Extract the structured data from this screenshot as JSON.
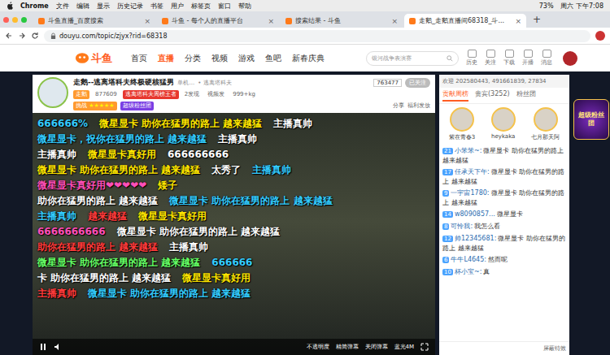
{
  "menubar": {
    "app": "Chrome",
    "items": [
      "文件",
      "编辑",
      "显示",
      "历史记录",
      "书签",
      "用户",
      "标签页",
      "窗口",
      "帮助"
    ],
    "battery": "73%",
    "clock": "周六 下午7:08"
  },
  "tabs": [
    {
      "label": "斗鱼直播_百度搜索",
      "selected": false
    },
    {
      "label": "斗鱼 - 每个人的直播平台",
      "selected": false
    },
    {
      "label": "搜索结果 - 斗鱼",
      "selected": false
    },
    {
      "label": "走鹅_走鹅直播间68318_斗...",
      "selected": true
    }
  ],
  "tab_close": "×",
  "new_tab": "+",
  "address": "douyu.com/topic/zjyx?rid=68318",
  "site_nav": {
    "logo": "斗鱼",
    "links": [
      {
        "label": "首页",
        "selected": false
      },
      {
        "label": "直播",
        "selected": true
      },
      {
        "label": "分类",
        "selected": false
      },
      {
        "label": "视频",
        "selected": false
      },
      {
        "label": "游戏",
        "selected": false
      },
      {
        "label": "鱼吧",
        "selected": false
      },
      {
        "label": "新春庆典",
        "selected": false
      }
    ],
    "search_placeholder": "银河战争表演赛",
    "actions": [
      "历史",
      "关注",
      "下载",
      "开播",
      "消息"
    ]
  },
  "room": {
    "title": "走鹅--逃离塔科夫终极硬核猛男",
    "category": "单机...",
    "game": "• 逃离塔科夫",
    "room_id": "763477",
    "follow": "已关注",
    "anchor": "走鹅",
    "hot": "877609",
    "rank_badge": "逃离塔科夫周榜王者",
    "stats": [
      "2发现",
      "视频发",
      "999+kg"
    ],
    "level_label": "挑战",
    "star_glyph": "★",
    "stars": 5,
    "fan_club": "超级粉丝团",
    "share": "分享",
    "welfare": "福利发放"
  },
  "danmaku_rows": [
    [
      {
        "text": "666666%",
        "color": "#33ccff"
      },
      {
        "text": "微星显卡 助你在猛男的路上 越来越猛",
        "color": "#ffe600"
      },
      {
        "text": "主播真帅",
        "color": "#ffffff"
      }
    ],
    [
      {
        "text": "微星显卡，祝你在猛男的路上 越来越猛",
        "color": "#33ccff"
      },
      {
        "text": "主播真帅",
        "color": "#ffffff"
      }
    ],
    [
      {
        "text": "主播真帅",
        "color": "#ffffff"
      },
      {
        "text": "微星显卡真好用",
        "color": "#ffe600"
      },
      {
        "text": "666666666",
        "color": "#ffffff"
      }
    ],
    [
      {
        "text": "微星显卡 助你在猛男的路上 越来越猛",
        "color": "#ffe600"
      },
      {
        "text": "太秀了",
        "color": "#ffffff"
      },
      {
        "text": "主播真帅",
        "color": "#33ccff"
      }
    ],
    [
      {
        "text": "微星显卡真好用❤❤❤❤❤",
        "color": "#ff4fb8"
      },
      {
        "text": "矮子",
        "color": "#ffe600"
      }
    ],
    [
      {
        "text": "助你在猛男的路上 越来越猛",
        "color": "#ffffff"
      },
      {
        "text": "微星显卡 助你在猛男的路上 越来越猛",
        "color": "#33ccff"
      }
    ],
    [
      {
        "text": "主播真帅",
        "color": "#33ccff"
      },
      {
        "text": "越来越猛",
        "color": "#ff3b3b"
      },
      {
        "text": "微星显卡真好用",
        "color": "#ffe600"
      }
    ],
    [
      {
        "text": "6666666666",
        "color": "#ff4fb8"
      },
      {
        "text": "微星显卡 助你在猛男的路上 越来越猛",
        "color": "#ffffff"
      }
    ],
    [
      {
        "text": "助你在猛男的路上 越来越猛",
        "color": "#ff3b3b"
      },
      {
        "text": "主播真帅",
        "color": "#ffffff"
      }
    ],
    [
      {
        "text": "微星显卡 助你在猛男的路上 越来越猛",
        "color": "#66ff66"
      },
      {
        "text": "666666",
        "color": "#33ccff"
      }
    ],
    [
      {
        "text": "卡 助你在猛男的路上 越来越猛",
        "color": "#ffffff"
      },
      {
        "text": "微星显卡真好用",
        "color": "#ffe600"
      }
    ],
    [
      {
        "text": "主播真帅",
        "color": "#ff3b3b"
      },
      {
        "text": "微星显卡 助你在猛男的路上 越来越猛",
        "color": "#33ccff"
      }
    ]
  ],
  "player_controls": {
    "quality": "蓝光4M",
    "opacity": "不透明度",
    "simple": "精简弹幕",
    "close": "关闭弹幕"
  },
  "side": {
    "welcome": "欢迎 202580443, 491661839, 27834",
    "tabs": [
      {
        "label": "贡献周榜",
        "selected": true
      },
      {
        "label": "贵宾(3252)",
        "selected": false
      },
      {
        "label": "粉丝团",
        "selected": false
      }
    ],
    "top3": [
      "紫在青春3",
      "heykaka",
      "七月那天阿"
    ],
    "chat": [
      {
        "level": "21",
        "user": "小笨笨~:",
        "text": "微星显卡 助你在猛男的路上 越来越猛"
      },
      {
        "level": "17",
        "user": "任承天下午:",
        "text": "微星显卡 助你在猛男的路上 越来越猛"
      },
      {
        "level": "9",
        "user": "一宇宙1780:",
        "text": "微星显卡 助你在猛男的路上 越来越猛"
      },
      {
        "level": "14",
        "user": "w8090857...",
        "text": "微星显卡"
      },
      {
        "level": "8",
        "user": "可怜我:",
        "text": "我怎么看"
      },
      {
        "level": "12",
        "user": "帅12345681:",
        "text": "微星显卡 助你在猛男的路上 越来越猛"
      },
      {
        "level": "6",
        "user": "牛牛L4645:",
        "text": "然而呢"
      },
      {
        "level": "10",
        "user": "杯小宝~:",
        "text": "真"
      }
    ],
    "footer": "屏蔽特效"
  },
  "promo": {
    "label": "超级粉丝团"
  }
}
